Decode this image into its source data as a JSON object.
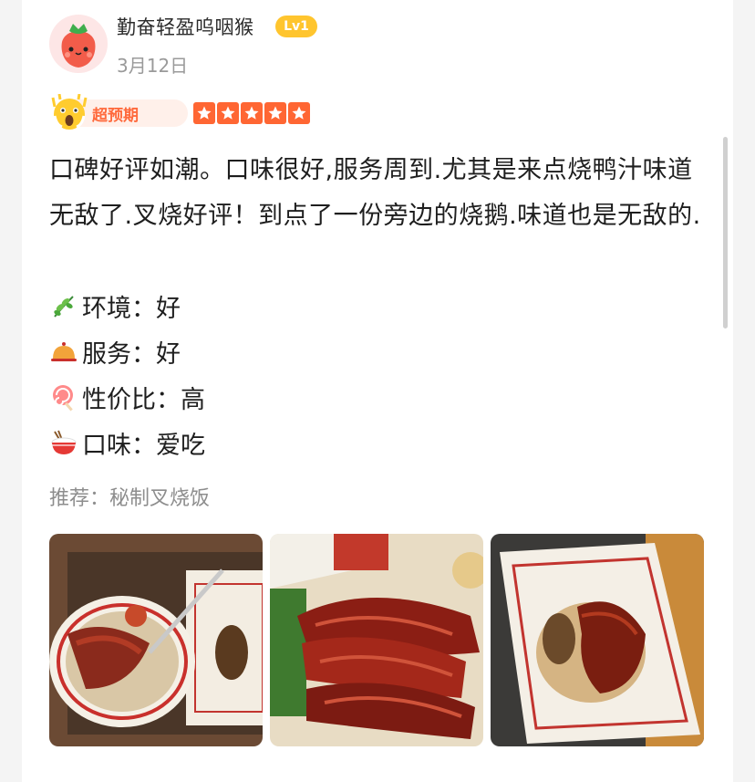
{
  "user": {
    "name": "勤奋轻盈呜咽猴",
    "level": "Lv1",
    "date": "3月12日"
  },
  "rating": {
    "tag": "超预期",
    "stars": 5,
    "max_stars": 5,
    "star_color": "#ff6633"
  },
  "review": {
    "text": "口碑好评如潮。口味很好,服务周到.尤其是来点烧鸭汁味道无敌了.叉烧好评！到点了一份旁边的烧鹅.味道也是无敌的."
  },
  "attributes": [
    {
      "icon": "herb-icon",
      "label": "环境：",
      "value": "好"
    },
    {
      "icon": "service-bell-icon",
      "label": "服务：",
      "value": "好"
    },
    {
      "icon": "lollipop-icon",
      "label": "性价比：",
      "value": "高"
    },
    {
      "icon": "rice-bowl-icon",
      "label": "口味：",
      "value": "爱吃"
    }
  ],
  "recommend": "推荐：秘制叉烧饭",
  "colors": {
    "level_badge": "#ffc52e",
    "tag_text": "#ff6a3d",
    "tag_bg": "#fff0ea"
  }
}
